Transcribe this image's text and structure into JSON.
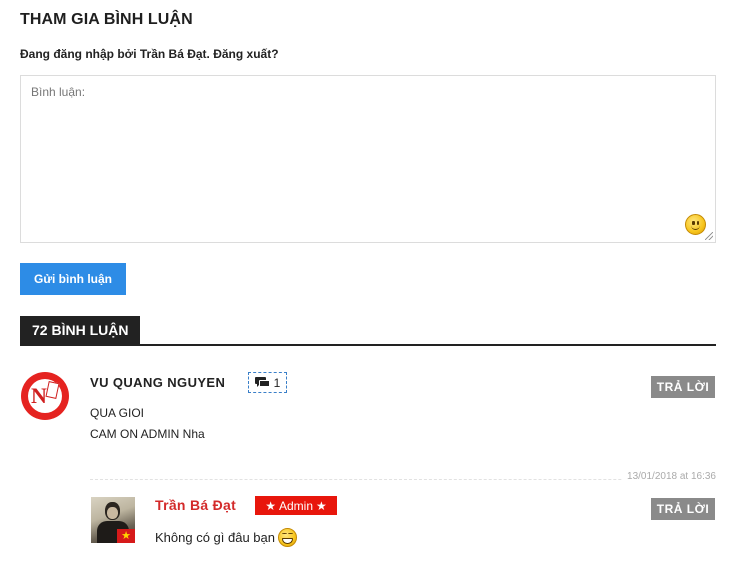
{
  "form": {
    "title": "THAM GIA BÌNH LUẬN",
    "logged_in_prefix": "Đang đăng nhập bởi ",
    "user_name": "Trần Bá Đạt",
    "sep": ". ",
    "logout": "Đăng xuất",
    "suffix": "?",
    "comment_placeholder": "Bình luận:",
    "submit_label": "Gửi bình luận"
  },
  "comments_header": {
    "count_label": "72 BÌNH LUẬN"
  },
  "comments": [
    {
      "author": "VU QUANG NGUYEN",
      "reply_count": "1",
      "reply_label": "TRẢ LỜI",
      "lines": [
        "QUA GIOI",
        "CAM ON ADMIN Nha"
      ],
      "date": "13/01/2018 at 16:36"
    }
  ],
  "replies": [
    {
      "author": "Trần Bá Đạt",
      "badge": "Admin",
      "reply_label": "TRẢ LỜI",
      "text": "Không có gì đâu bạn"
    }
  ],
  "colors": {
    "submit_button": "#2d8ce6",
    "reply_button": "#8a8a8a",
    "admin_badge": "#e8160c",
    "admin_name": "#d32a2a",
    "count_bar": "#222222"
  },
  "icons": {
    "emoji": "smiley-icon",
    "reply_count": "speech-bubbles-icon",
    "badge": "star-icon",
    "inline_emoji": "grin-icon"
  }
}
